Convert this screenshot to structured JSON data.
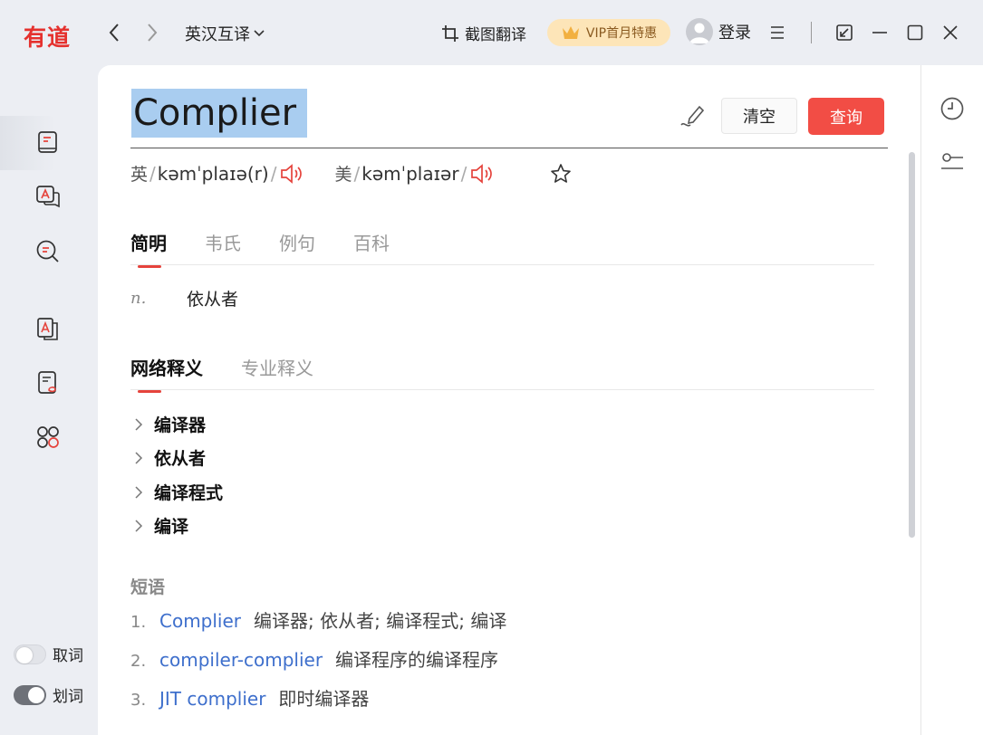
{
  "app": {
    "logo": "有道"
  },
  "header": {
    "lang_mode": "英汉互译",
    "screenshot_translate": "截图翻译",
    "vip": "VIP首月特惠",
    "login": "登录"
  },
  "sidebar": {
    "toggles": [
      {
        "label": "取词",
        "on": false
      },
      {
        "label": "划词",
        "on": true
      }
    ]
  },
  "query": {
    "text": "Complier",
    "clear_label": "清空",
    "search_label": "查询"
  },
  "phonetics": {
    "uk_label": "英",
    "uk_ipa": "kəmˈplaɪə(r)",
    "us_label": "美",
    "us_ipa": "kəmˈplaɪər"
  },
  "tabs": [
    {
      "label": "简明",
      "active": true
    },
    {
      "label": "韦氏",
      "active": false
    },
    {
      "label": "例句",
      "active": false
    },
    {
      "label": "百科",
      "active": false
    }
  ],
  "basic": {
    "pos": "n.",
    "definition": "依从者"
  },
  "web_tabs": [
    {
      "label": "网络释义",
      "active": true
    },
    {
      "label": "专业释义",
      "active": false
    }
  ],
  "web_defs": [
    "编译器",
    "依从者",
    "编译程式",
    "编译"
  ],
  "phrases": {
    "heading": "短语",
    "items": [
      {
        "num": "1.",
        "en": "Complier",
        "zh": "编译器; 依从者; 编译程式; 编译"
      },
      {
        "num": "2.",
        "en": "compiler-complier",
        "zh": "编译程序的编译程序"
      },
      {
        "num": "3.",
        "en": "JIT complier",
        "zh": "即时编译器"
      }
    ]
  },
  "colors": {
    "accent": "#f24d45",
    "link": "#3e6fcc",
    "brand": "#e5312e"
  }
}
